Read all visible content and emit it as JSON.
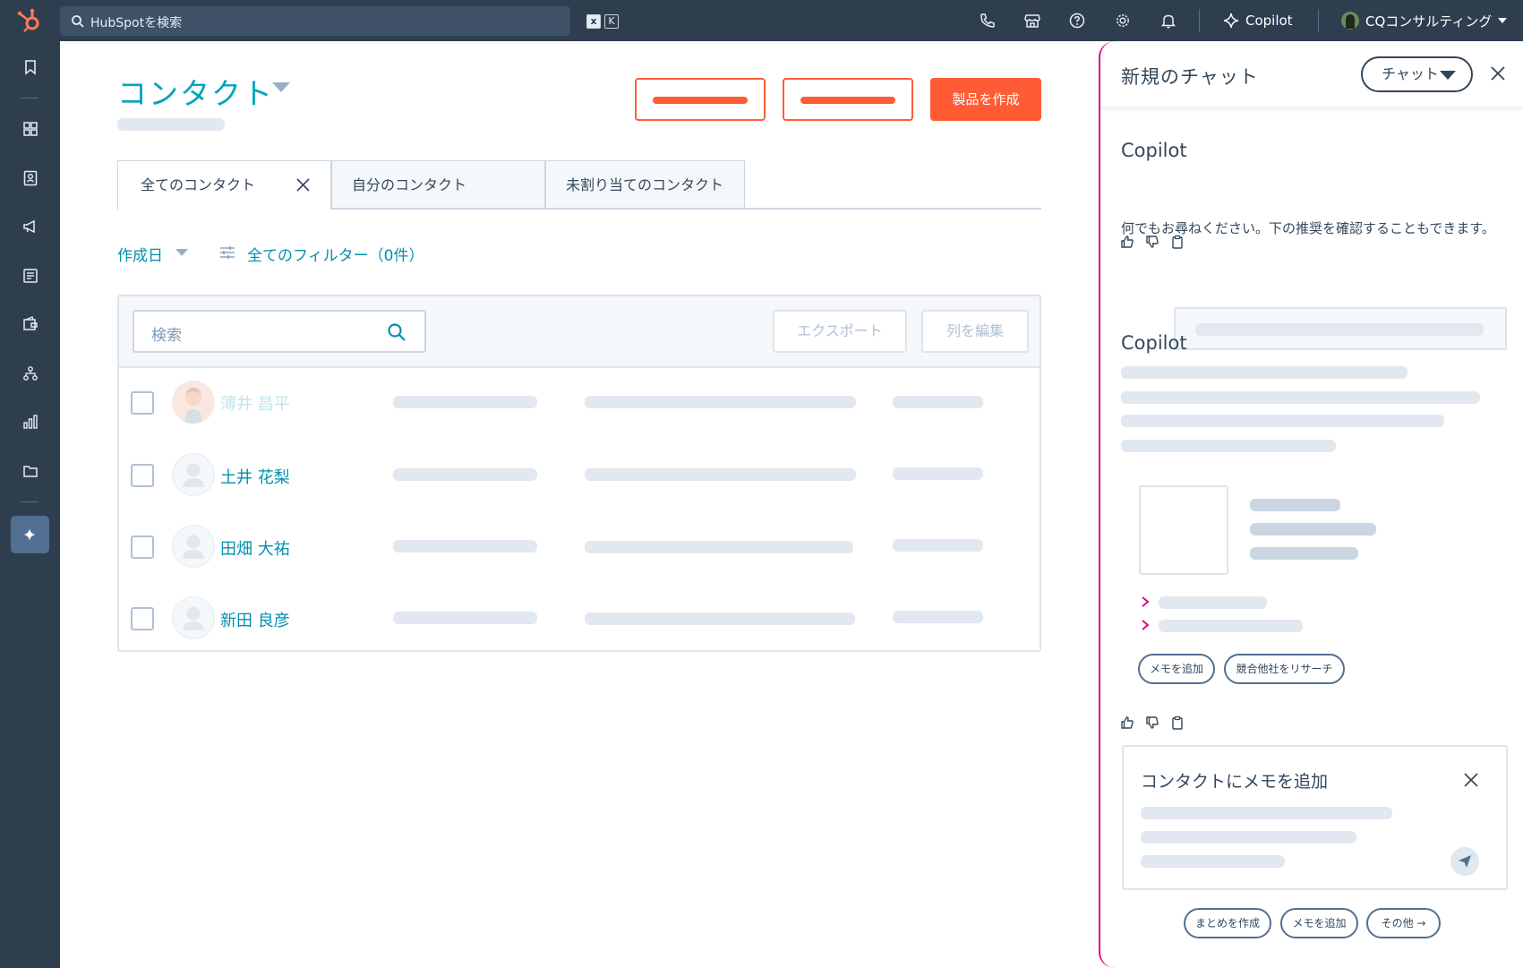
{
  "topbar": {
    "search_placeholder": "HubSpotを検索",
    "kbd_x": "x",
    "kbd_k": "K",
    "copilot_label": "Copilot",
    "account_name": "CQコンサルティング"
  },
  "main": {
    "title": "コンタクト",
    "create_button": "製品を作成",
    "tabs": [
      {
        "label": "全てのコンタクト"
      },
      {
        "label": "自分のコンタクト"
      },
      {
        "label": "未割り当てのコンタクト"
      }
    ],
    "filters": {
      "date_label": "作成日",
      "all_filters_label": "全てのフィルター（0件）"
    },
    "table": {
      "search_placeholder": "検索",
      "export_label": "エクスポート",
      "edit_columns_label": "列を編集",
      "rows": [
        {
          "name": "薄井 昌平"
        },
        {
          "name": "土井 花梨"
        },
        {
          "name": "田畑 大祐"
        },
        {
          "name": "新田 良彦"
        }
      ]
    }
  },
  "panel": {
    "title": "新規のチャット",
    "chat_dropdown": "チャット",
    "copilot_label_1": "Copilot",
    "copilot_message": "何でもお尋ねください。下の推奨を確認することもできます。",
    "copilot_label_2": "Copilot",
    "suggestion_pills": [
      "メモを追加",
      "競合他社をリサーチ"
    ],
    "note_title": "コンタクトにメモを追加",
    "bottom_pills": [
      "まとめを作成",
      "メモを追加",
      "その他 →"
    ]
  },
  "colors": {
    "brand_orange": "#ff5c35",
    "teal": "#00a4bd",
    "nav_dark": "#2e3e4f",
    "copilot_magenta": "#d80a8c"
  }
}
